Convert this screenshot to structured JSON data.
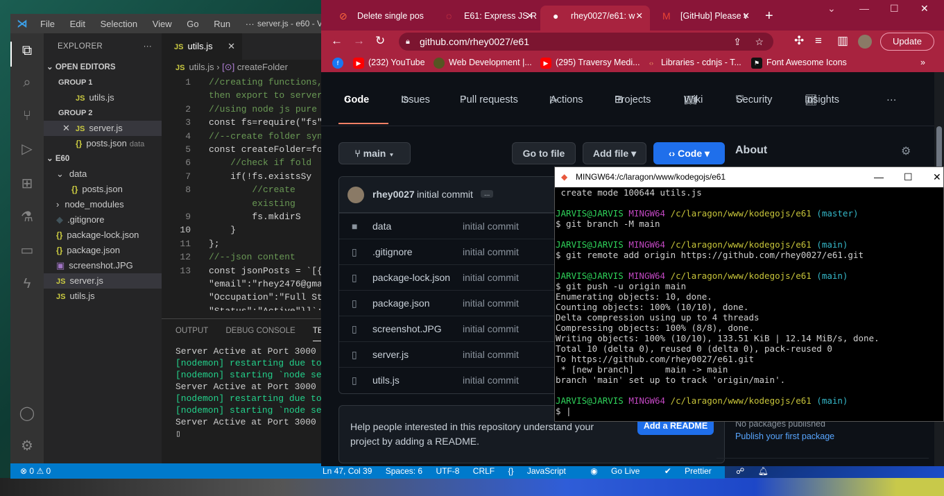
{
  "vscode": {
    "menu": [
      "File",
      "Edit",
      "Selection",
      "View",
      "Go",
      "Run",
      "···"
    ],
    "window_title": "server.js - e60 - V",
    "explorer_title": "EXPLORER",
    "explorer_more": "···",
    "open_editors": "OPEN EDITORS",
    "group1": "GROUP 1",
    "group1_file": "utils.js",
    "group2": "GROUP 2",
    "group2_file": "server.js",
    "group2_file2": "posts.json",
    "group2_file2_hint": "data",
    "folder": "E60",
    "tree": [
      {
        "name": "data",
        "type": "folder-open"
      },
      {
        "name": "posts.json",
        "type": "json"
      },
      {
        "name": "node_modules",
        "type": "folder"
      },
      {
        "name": ".gitignore",
        "type": "git"
      },
      {
        "name": "package-lock.json",
        "type": "json"
      },
      {
        "name": "package.json",
        "type": "json"
      },
      {
        "name": "screenshot.JPG",
        "type": "image"
      },
      {
        "name": "server.js",
        "type": "js"
      },
      {
        "name": "utils.js",
        "type": "js"
      }
    ],
    "tab": "utils.js",
    "breadcrumb_file": "utils.js",
    "breadcrumb_symbol": "createFolder",
    "code": [
      {
        "n": "1",
        "t": "//creating functions,"
      },
      {
        "n": "",
        "t": "then export to server"
      },
      {
        "n": "2",
        "t": "//using node js pure"
      },
      {
        "n": "3",
        "t": "const fs=require(\"fs\""
      },
      {
        "n": "4",
        "t": "//--create folder syn"
      },
      {
        "n": "5",
        "t": "const createFolder=fo"
      },
      {
        "n": "6",
        "t": "    //check if fold"
      },
      {
        "n": "7",
        "t": "    if(!fs.existsSy"
      },
      {
        "n": "8",
        "t": "        //create"
      },
      {
        "n": "",
        "t": "        existing"
      },
      {
        "n": "9",
        "t": "        fs.mkdirS"
      },
      {
        "n": "10",
        "t": "    }"
      },
      {
        "n": "11",
        "t": "};"
      },
      {
        "n": "12",
        "t": "//--json content"
      },
      {
        "n": "13",
        "t": "const jsonPosts = `[{"
      },
      {
        "n": "",
        "t": "\"email\":\"rhey2476@gma"
      },
      {
        "n": "",
        "t": "\"Occupation\":\"Full St"
      },
      {
        "n": "",
        "t": "\"Status\":\"Active\"}]`;"
      }
    ],
    "panel_tabs": [
      "OUTPUT",
      "DEBUG CONSOLE",
      "TERMIN"
    ],
    "terminal": [
      "Server Active at Port 3000",
      "[nodemon] restarting due to ch",
      "[nodemon] starting `node serve",
      "Server Active at Port 3000",
      "[nodemon] restarting due to ch",
      "[nodemon] starting `node serve",
      "Server Active at Port 3000"
    ],
    "status": {
      "errors": "0",
      "warnings": "0",
      "position": "Ln 47, Col 39",
      "spaces": "Spaces: 6",
      "encoding": "UTF-8",
      "eol": "CRLF",
      "language": "JavaScript",
      "golive": "Go Live",
      "prettier": "Prettier"
    }
  },
  "chrome": {
    "tabs": [
      {
        "title": "Delete single pos",
        "icon": "hashnode-icon"
      },
      {
        "title": "E61: Express JS R",
        "icon": "loading-icon"
      },
      {
        "title": "rhey0027/e61: w",
        "icon": "github-icon"
      },
      {
        "title": "[GitHub] Please v",
        "icon": "gmail-icon"
      }
    ],
    "new_tab": "+",
    "url": "github.com/rhey0027/e61",
    "update_label": "Update",
    "bookmarks": [
      {
        "label": "(232) YouTube"
      },
      {
        "label": "Web Development |..."
      },
      {
        "label": "(295) Traversy Medi..."
      },
      {
        "label": "Libraries - cdnjs - T..."
      },
      {
        "label": "Font Awesome Icons"
      }
    ],
    "bookmarks_more": "»"
  },
  "github": {
    "nav": [
      "Code",
      "Issues",
      "Pull requests",
      "Actions",
      "Projects",
      "Wiki",
      "Security",
      "Insights"
    ],
    "more": "···",
    "branch": "main",
    "goto_file": "Go to file",
    "add_file": "Add file",
    "code_btn": "Code",
    "about": "About",
    "commit_author": "rhey0027",
    "commit_msg": "initial commit",
    "commit_more": "...",
    "files": [
      {
        "name": "data",
        "msg": "initial commit",
        "type": "folder"
      },
      {
        "name": ".gitignore",
        "msg": "initial commit",
        "type": "file"
      },
      {
        "name": "package-lock.json",
        "msg": "initial commit",
        "type": "file"
      },
      {
        "name": "package.json",
        "msg": "initial commit",
        "type": "file"
      },
      {
        "name": "screenshot.JPG",
        "msg": "initial commit",
        "type": "file"
      },
      {
        "name": "server.js",
        "msg": "initial commit",
        "type": "file"
      },
      {
        "name": "utils.js",
        "msg": "initial commit",
        "type": "file"
      }
    ],
    "readme_text": "Help people interested in this repository understand your project by adding a README.",
    "readme_btn": "Add a README",
    "no_packages": "No packages published",
    "publish_package": "Publish your first package"
  },
  "mintty": {
    "title": "MINGW64:/c/laragon/www/kodegojs/e61",
    "lines": [
      {
        "kind": "plain",
        "text": " create mode 100644 utils.js"
      },
      {
        "kind": "blank",
        "text": ""
      },
      {
        "kind": "prompt",
        "user": "JARVIS@JARVIS",
        "sys": "MINGW64",
        "path": "/c/laragon/www/kodegojs/e61",
        "branch": "(master)"
      },
      {
        "kind": "plain",
        "text": "$ git branch -M main"
      },
      {
        "kind": "blank",
        "text": ""
      },
      {
        "kind": "prompt",
        "user": "JARVIS@JARVIS",
        "sys": "MINGW64",
        "path": "/c/laragon/www/kodegojs/e61",
        "branch": "(main)"
      },
      {
        "kind": "plain",
        "text": "$ git remote add origin https://github.com/rhey0027/e61.git"
      },
      {
        "kind": "blank",
        "text": ""
      },
      {
        "kind": "prompt",
        "user": "JARVIS@JARVIS",
        "sys": "MINGW64",
        "path": "/c/laragon/www/kodegojs/e61",
        "branch": "(main)"
      },
      {
        "kind": "plain",
        "text": "$ git push -u origin main"
      },
      {
        "kind": "plain",
        "text": "Enumerating objects: 10, done."
      },
      {
        "kind": "plain",
        "text": "Counting objects: 100% (10/10), done."
      },
      {
        "kind": "plain",
        "text": "Delta compression using up to 4 threads"
      },
      {
        "kind": "plain",
        "text": "Compressing objects: 100% (8/8), done."
      },
      {
        "kind": "plain",
        "text": "Writing objects: 100% (10/10), 133.51 KiB | 12.14 MiB/s, done."
      },
      {
        "kind": "plain",
        "text": "Total 10 (delta 0), reused 0 (delta 0), pack-reused 0"
      },
      {
        "kind": "plain",
        "text": "To https://github.com/rhey0027/e61.git"
      },
      {
        "kind": "plain",
        "text": " * [new branch]      main -> main"
      },
      {
        "kind": "plain",
        "text": "branch 'main' set up to track 'origin/main'."
      },
      {
        "kind": "blank",
        "text": ""
      },
      {
        "kind": "prompt",
        "user": "JARVIS@JARVIS",
        "sys": "MINGW64",
        "path": "/c/laragon/www/kodegojs/e61",
        "branch": "(main)"
      },
      {
        "kind": "plain",
        "text": "$ "
      }
    ]
  },
  "colors": {
    "vscode_status": "#007acc",
    "chrome_theme": "#a8233f",
    "github_blue": "#1f6feb",
    "terminal_green": "#2fd45b"
  }
}
